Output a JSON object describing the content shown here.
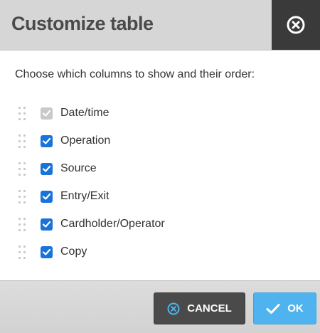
{
  "dialog": {
    "title": "Customize table",
    "close_icon": "close-circle-icon"
  },
  "instruction": "Choose which columns to show and their order:",
  "columns": [
    {
      "label": "Date/time",
      "checked": true,
      "disabled": true
    },
    {
      "label": "Operation",
      "checked": true,
      "disabled": false
    },
    {
      "label": "Source",
      "checked": true,
      "disabled": false
    },
    {
      "label": "Entry/Exit",
      "checked": true,
      "disabled": false
    },
    {
      "label": "Cardholder/Operator",
      "checked": true,
      "disabled": false
    },
    {
      "label": "Copy",
      "checked": true,
      "disabled": false
    }
  ],
  "footer": {
    "cancel_label": "CANCEL",
    "ok_label": "OK"
  },
  "colors": {
    "accent_blue": "#1a73d9",
    "ok_button": "#4fb3ef",
    "cancel_icon": "#4fb3ef",
    "header_bg": "#d6d6d6",
    "close_bg": "#3a3a3a"
  }
}
